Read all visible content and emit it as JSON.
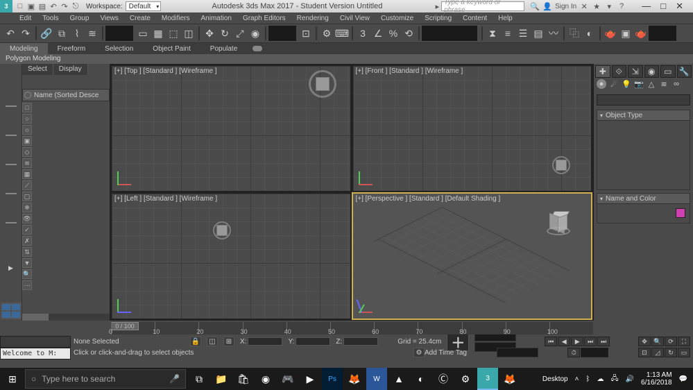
{
  "title_bar": {
    "app_title": "Autodesk 3ds Max 2017 - Student Version   Untitled",
    "workspace_label": "Workspace:",
    "workspace_value": "Default",
    "search_placeholder": "Type a keyword or phrase",
    "sign_in": "Sign In"
  },
  "menu": [
    "Edit",
    "Tools",
    "Group",
    "Views",
    "Create",
    "Modifiers",
    "Animation",
    "Graph Editors",
    "Rendering",
    "Civil View",
    "Customize",
    "Scripting",
    "Content",
    "Help"
  ],
  "ribbon": {
    "tabs": [
      "Modeling",
      "Freeform",
      "Selection",
      "Object Paint",
      "Populate"
    ],
    "active": 0,
    "sub": "Polygon Modeling"
  },
  "scene_explorer": {
    "tabs": [
      "Select",
      "Display"
    ],
    "header": "Name (Sorted Desce"
  },
  "viewports": {
    "top": "[+] [Top ] [Standard ] [Wireframe ]",
    "front": "[+] [Front ] [Standard ] [Wireframe ]",
    "left": "[+] [Left ] [Standard ] [Wireframe ]",
    "persp": "[+] [Perspective ] [Standard ] [Default Shading ]"
  },
  "command_panel": {
    "rollouts": {
      "object_type": "Object Type",
      "name_color": "Name and Color"
    }
  },
  "timeline": {
    "ticks": [
      "0",
      "10",
      "20",
      "30",
      "40",
      "50",
      "60",
      "70",
      "80",
      "90",
      "100"
    ],
    "slider": "0 / 100"
  },
  "status": {
    "selection": "None Selected",
    "prompt": "Click or click-and-drag to select objects",
    "welcome": "Welcome to M:",
    "x_label": "X:",
    "y_label": "Y:",
    "z_label": "Z:",
    "grid": "Grid = 25.4cm",
    "add_time_tag": "Add Time Tag",
    "desktop": "Desktop"
  },
  "taskbar": {
    "search_placeholder": "Type here to search",
    "time": "1:13 AM",
    "date": "6/16/2018"
  }
}
